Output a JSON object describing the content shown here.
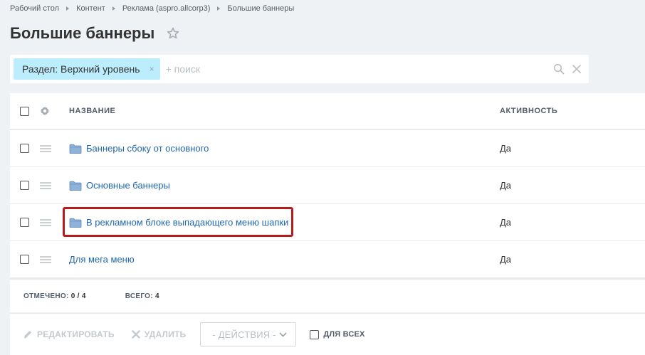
{
  "breadcrumbs": [
    "Рабочий стол",
    "Контент",
    "Реклама (aspro.allcorp3)",
    "Большие баннеры"
  ],
  "page_title": "Большие баннеры",
  "filter": {
    "chip_label": "Раздел: Верхний уровень",
    "chip_close": "×",
    "placeholder": "+ поиск"
  },
  "grid": {
    "columns": {
      "name": "НАЗВАНИЕ",
      "active": "АКТИВНОСТЬ"
    },
    "rows": [
      {
        "name": "Баннеры сбоку от основного",
        "active": "Да",
        "type": "folder"
      },
      {
        "name": "Основные баннеры",
        "active": "Да",
        "type": "folder"
      },
      {
        "name": "В рекламном блоке выпадающего меню шапки",
        "active": "Да",
        "type": "folder"
      },
      {
        "name": "Для мега меню",
        "active": "Да",
        "type": "element"
      }
    ],
    "footer": {
      "selected_label": "ОТМЕЧЕНО:",
      "selected_value": "0 / 4",
      "total_label": "ВСЕГО:",
      "total_value": "4"
    }
  },
  "actions": {
    "edit": "РЕДАКТИРОВАТЬ",
    "delete": "УДАЛИТЬ",
    "select": "- ДЕЙСТВИЯ -",
    "for_all": "ДЛЯ ВСЕХ"
  },
  "colors": {
    "link": "#2067b0",
    "chip_bg": "#bcedfc",
    "highlight": "#b71c1c",
    "page_bg": "#eef2f4"
  }
}
